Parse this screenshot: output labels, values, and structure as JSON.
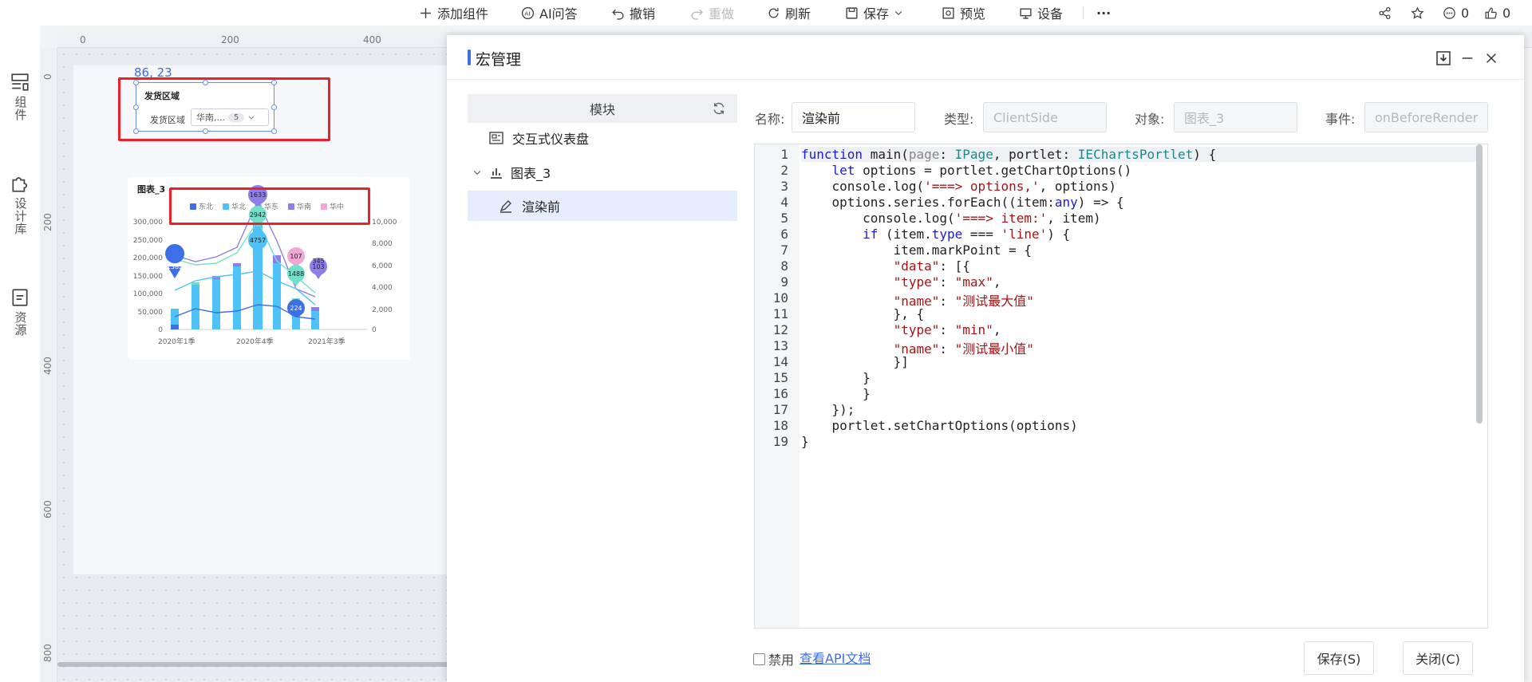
{
  "toolbar": {
    "add_component": "添加组件",
    "ai_qa": "AI问答",
    "undo": "撤销",
    "redo": "重做",
    "refresh": "刷新",
    "save": "保存",
    "preview": "预览",
    "device": "设备",
    "more": "···",
    "comment_count": "0",
    "like_count": "0"
  },
  "leftnav": {
    "components": "组件",
    "design_lib": "设计库",
    "resources": "资源"
  },
  "rulers": {
    "h": [
      "0",
      "200",
      "400"
    ],
    "v": [
      "0",
      "200",
      "400",
      "600",
      "800"
    ]
  },
  "canvas": {
    "coords": "86, 23",
    "filter": {
      "title": "发货区域",
      "label": "发货区域",
      "value": "华南,...",
      "count": "5"
    },
    "chart": {
      "title": "图表_3",
      "legend": [
        "东北",
        "华北",
        "华东",
        "华南",
        "华中"
      ],
      "y_left": [
        "300,000",
        "250,000",
        "200,000",
        "150,000",
        "100,000",
        "50,000",
        "0"
      ],
      "y_right": [
        "10,000",
        "8,000",
        "6,000",
        "4,000",
        "2,000",
        "0"
      ],
      "x_labels": [
        "2020年1季",
        "2020年4季",
        "2021年3季"
      ],
      "markers": [
        "1633",
        "2942",
        "4757",
        "1382",
        "107",
        "1488",
        "224",
        "103",
        "345"
      ]
    }
  },
  "dialog": {
    "title": "宏管理",
    "module_header": "模块",
    "tree": [
      {
        "label": "交互式仪表盘"
      },
      {
        "label": "图表_3"
      },
      {
        "label": "渲染前"
      }
    ],
    "form": {
      "name_label": "名称:",
      "name_value": "渲染前",
      "type_label": "类型:",
      "type_value": "ClientSide",
      "target_label": "对象:",
      "target_value": "图表_3",
      "event_label": "事件:",
      "event_value": "onBeforeRender"
    },
    "line_numbers": [
      "1",
      "2",
      "3",
      "4",
      "5",
      "6",
      "7",
      "8",
      "9",
      "10",
      "11",
      "12",
      "13",
      "14",
      "15",
      "16",
      "17",
      "18",
      "19"
    ],
    "disable_label": "禁用",
    "api_doc_link": "查看API文档",
    "save_button": "保存(S)",
    "close_button": "关闭(C)"
  }
}
